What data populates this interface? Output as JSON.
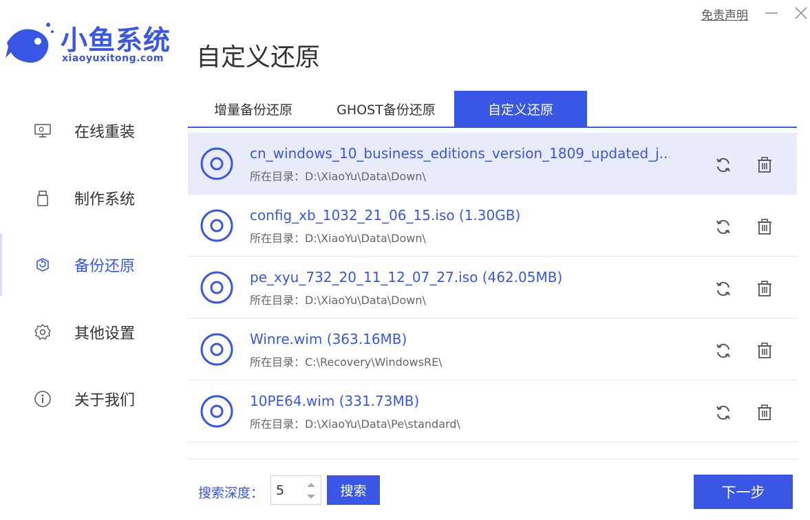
{
  "header": {
    "disclaimer_link": "免责声明",
    "minimize_icon": "minimize-icon",
    "close_icon": "close-icon"
  },
  "brand": {
    "name": "小鱼系统",
    "url": "xiaoyuxitong.com",
    "color": "#3a56e4"
  },
  "page_title": "自定义还原",
  "sidebar": {
    "items": [
      {
        "label": "在线重装",
        "icon": "monitor-icon",
        "active": false
      },
      {
        "label": "制作系统",
        "icon": "usb-drive-icon",
        "active": false
      },
      {
        "label": "备份还原",
        "icon": "backup-restore-icon",
        "active": true
      },
      {
        "label": "其他设置",
        "icon": "gear-icon",
        "active": false
      },
      {
        "label": "关于我们",
        "icon": "info-icon",
        "active": false
      }
    ]
  },
  "tabs": [
    {
      "label": "增量备份还原",
      "active": false
    },
    {
      "label": "GHOST备份还原",
      "active": false
    },
    {
      "label": "自定义还原",
      "active": true
    }
  ],
  "files": [
    {
      "name": "cn_windows_10_business_editions_version_1809_updated_j...",
      "dir": "所在目录：D:\\XiaoYu\\Data\\Down\\",
      "selected": true
    },
    {
      "name": "config_xb_1032_21_06_15.iso (1.30GB)",
      "dir": "所在目录：D:\\XiaoYu\\Data\\Down\\",
      "selected": false
    },
    {
      "name": "pe_xyu_732_20_11_12_07_27.iso (462.05MB)",
      "dir": "所在目录：D:\\XiaoYu\\Data\\Down\\",
      "selected": false
    },
    {
      "name": "Winre.wim (363.16MB)",
      "dir": "所在目录：C:\\Recovery\\WindowsRE\\",
      "selected": false
    },
    {
      "name": "10PE64.wim (331.73MB)",
      "dir": "所在目录：D:\\XiaoYu\\Data\\Pe\\standard\\",
      "selected": false
    }
  ],
  "footer": {
    "depth_label": "搜索深度：",
    "depth_value": "5",
    "search_button": "搜索",
    "next_button": "下一步"
  }
}
